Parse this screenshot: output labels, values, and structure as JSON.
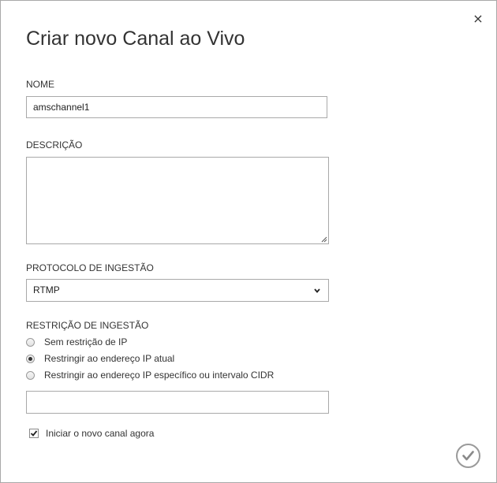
{
  "dialog": {
    "title": "Criar novo Canal ao Vivo",
    "close_label": "×"
  },
  "name_field": {
    "label": "NOME",
    "value": "amschannel1"
  },
  "description_field": {
    "label": "DESCRIÇÃO",
    "value": ""
  },
  "protocol_field": {
    "label": "PROTOCOLO DE INGESTÃO",
    "selected": "RTMP"
  },
  "restriction": {
    "label": "RESTRIÇÃO DE INGESTÃO",
    "options": [
      {
        "label": "Sem restrição de IP",
        "checked": false
      },
      {
        "label": "Restringir ao endereço IP atual",
        "checked": true
      },
      {
        "label": "Restringir ao endereço IP específico ou intervalo CIDR",
        "checked": false
      }
    ],
    "ip_value": ""
  },
  "start_now": {
    "label": "Iniciar o novo canal agora",
    "checked": true
  },
  "icons": {
    "close": "close-icon",
    "dropdown": "chevron-down-icon",
    "confirm": "checkmark-icon",
    "check": "checkmark-icon"
  },
  "colors": {
    "border": "#a9a9a9",
    "text": "#333333"
  }
}
